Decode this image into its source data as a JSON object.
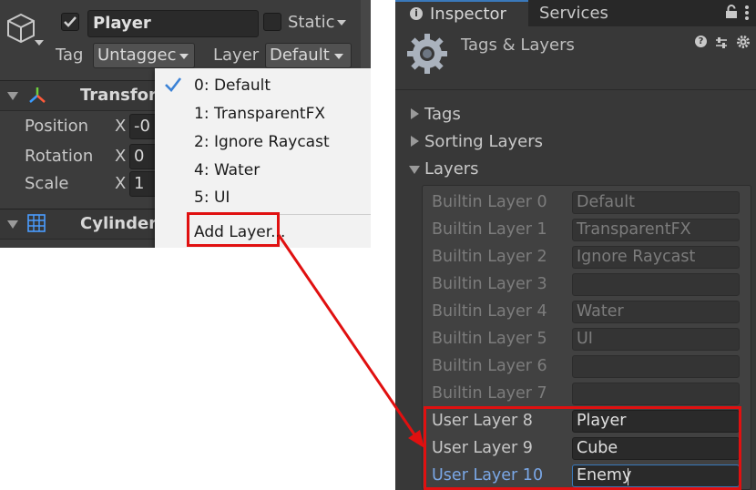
{
  "left": {
    "object_name": "Player",
    "static_label": "Static",
    "tag_label": "Tag",
    "tag_value": "Untaggec",
    "layer_label": "Layer",
    "layer_value": "Default",
    "transform_title": "Transfor",
    "position_label": "Position",
    "rotation_label": "Rotation",
    "scale_label": "Scale",
    "axis_x": "X",
    "position_x": "-0",
    "rotation_x": "0",
    "scale_x": "1",
    "cylinder_title": "Cylinder",
    "layer_menu": {
      "items": [
        "0: Default",
        "1: TransparentFX",
        "2: Ignore Raycast",
        "4: Water",
        "5: UI"
      ],
      "selected_index": 0,
      "add_layer": "Add Layer..."
    }
  },
  "right": {
    "tabs": [
      "Inspector",
      "Services"
    ],
    "panel_title": "Tags & Layers",
    "sections": [
      "Tags",
      "Sorting Layers",
      "Layers"
    ],
    "layers": [
      {
        "label": "Builtin Layer 0",
        "value": "Default"
      },
      {
        "label": "Builtin Layer 1",
        "value": "TransparentFX"
      },
      {
        "label": "Builtin Layer 2",
        "value": "Ignore Raycast"
      },
      {
        "label": "Builtin Layer 3",
        "value": ""
      },
      {
        "label": "Builtin Layer 4",
        "value": "Water"
      },
      {
        "label": "Builtin Layer 5",
        "value": "UI"
      },
      {
        "label": "Builtin Layer 6",
        "value": ""
      },
      {
        "label": "Builtin Layer 7",
        "value": ""
      },
      {
        "label": "User Layer 8",
        "value": "Player"
      },
      {
        "label": "User Layer 9",
        "value": "Cube"
      },
      {
        "label": "User Layer 10",
        "value": "Enemy"
      }
    ]
  },
  "colors": {
    "highlight_red": "#e01010",
    "accent_blue": "#3a79bb",
    "active_label_blue": "#7aa7e6"
  }
}
